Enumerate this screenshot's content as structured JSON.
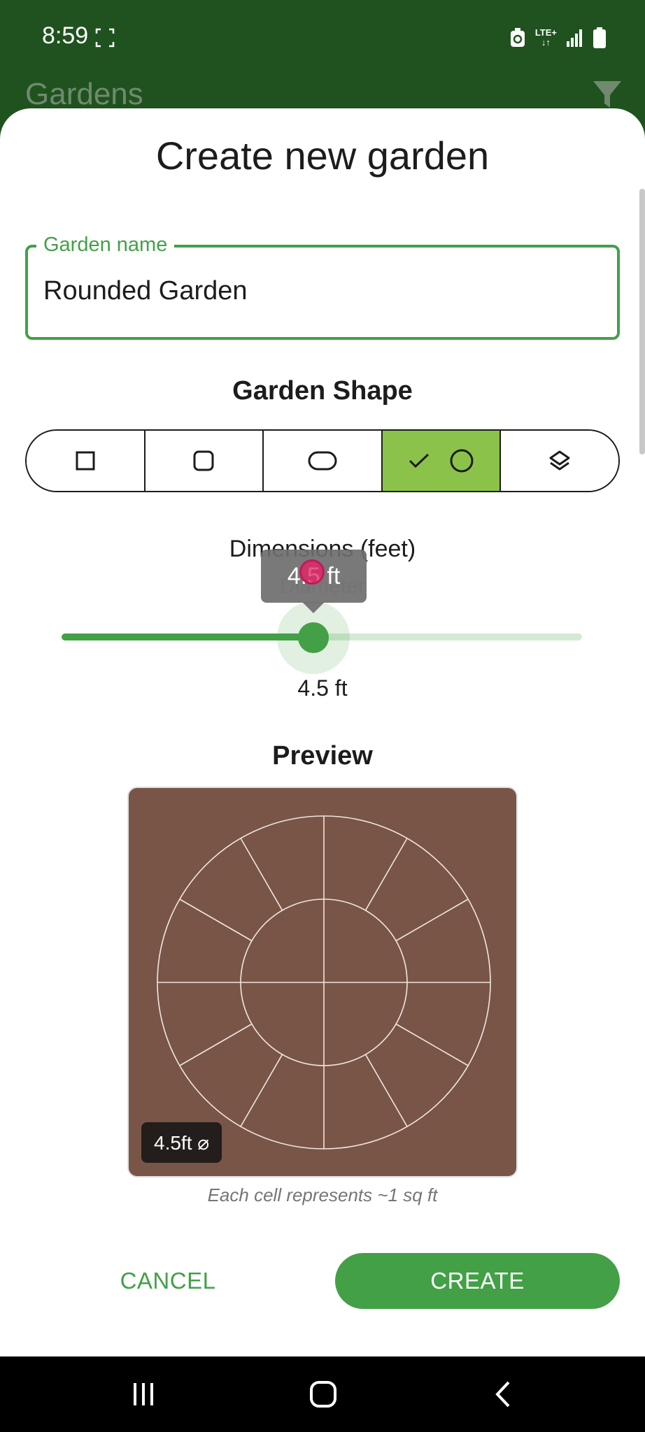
{
  "status_bar": {
    "time": "8:59",
    "network": "LTE+",
    "icons": [
      "screenshot-icon",
      "data-saver-icon",
      "signal-icon",
      "battery-icon"
    ]
  },
  "app_bar": {
    "title": "Gardens",
    "filter_icon": "filter-icon"
  },
  "dialog": {
    "title": "Create new garden",
    "name_field": {
      "label": "Garden name",
      "value": "Rounded Garden"
    },
    "shape": {
      "title": "Garden Shape",
      "options": [
        "square-icon",
        "rounded-square-icon",
        "pill-icon",
        "circle-icon",
        "layers-icon"
      ],
      "selected": "circle-icon"
    },
    "dimensions": {
      "title": "Dimensions (feet)",
      "sublabel": "Diameter",
      "tooltip": "4.5 ft",
      "value_label": "4.5 ft",
      "slider_fraction": 0.485
    },
    "preview": {
      "title": "Preview",
      "badge": "4.5ft ⌀",
      "caption": "Each cell represents ~1 sq ft",
      "inner_segments": 4,
      "outer_segments": 12
    },
    "actions": {
      "cancel": "CANCEL",
      "create": "CREATE"
    }
  },
  "colors": {
    "primary": "#43a047",
    "selected_segment": "#8bc34a",
    "app_bar": "#1f521f",
    "soil": "#795548"
  },
  "nav_bar": {
    "icons": [
      "recents-icon",
      "home-icon",
      "back-icon"
    ]
  }
}
